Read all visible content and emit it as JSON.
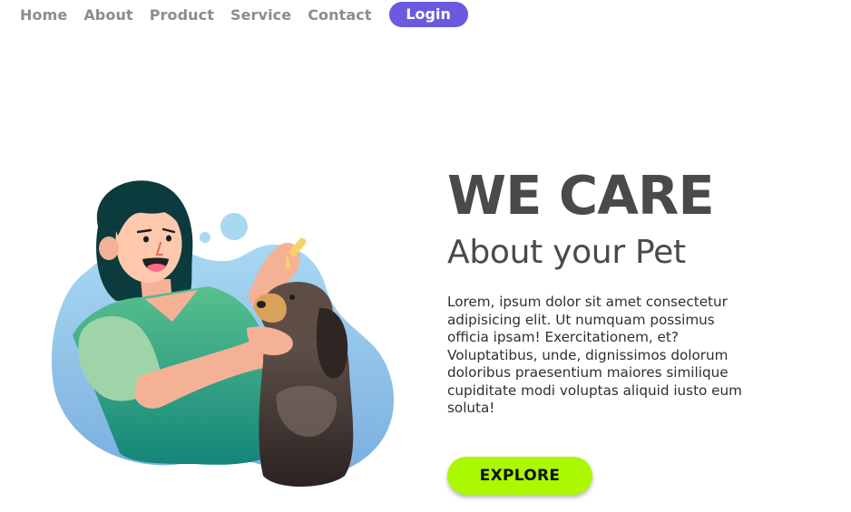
{
  "nav": {
    "links": [
      {
        "label": "Home"
      },
      {
        "label": "About"
      },
      {
        "label": "Product"
      },
      {
        "label": "Service"
      },
      {
        "label": "Contact"
      }
    ],
    "login_label": "Login"
  },
  "hero": {
    "title": "WE CARE",
    "subtitle": "About your Pet",
    "body": "Lorem, ipsum dolor sit amet consectetur adipisicing elit. Ut numquam possimus officia ipsam! Exercitationem, et? Voluptatibus, unde, dignissimos dolorum doloribus praesentium maiores similique cupiditate modi voluptas aliquid iusto eum soluta!",
    "cta_label": "EXPLORE"
  },
  "colors": {
    "accent": "#6a5ae0",
    "cta": "#aaf900",
    "heading": "#4a4a4a",
    "nav_text": "#8c8c8c"
  },
  "illustration": {
    "icon": "woman-with-dog-illustration"
  }
}
